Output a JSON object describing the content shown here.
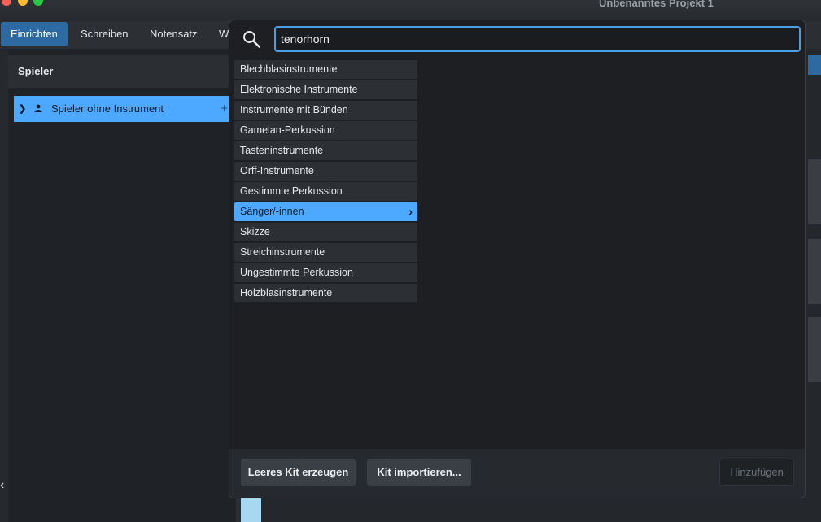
{
  "window": {
    "title": "Unbenanntes Projekt 1"
  },
  "tabs": [
    {
      "label": "Einrichten"
    },
    {
      "label": "Schreiben"
    },
    {
      "label": "Notensatz"
    },
    {
      "label": "W"
    }
  ],
  "players_panel": {
    "header": "Spieler",
    "player": {
      "label": "Spieler ohne Instrument",
      "add_glyph": "+"
    }
  },
  "picker": {
    "search": {
      "value": "tenorhorn",
      "placeholder": ""
    },
    "categories": [
      {
        "label": "Blechblasinstrumente"
      },
      {
        "label": "Elektronische Instrumente"
      },
      {
        "label": "Instrumente mit Bünden"
      },
      {
        "label": "Gamelan-Perkussion"
      },
      {
        "label": "Tasteninstrumente"
      },
      {
        "label": "Orff-Instrumente"
      },
      {
        "label": "Gestimmte Perkussion"
      },
      {
        "label": "Sänger/-innen"
      },
      {
        "label": "Skizze"
      },
      {
        "label": "Streichinstrumente"
      },
      {
        "label": "Ungestimmte Perkussion"
      },
      {
        "label": "Holzblasinstrumente"
      }
    ],
    "selected_category": "Sänger/-innen",
    "buttons": {
      "empty_kit": "Leeres Kit erzeugen",
      "import_kit": "Kit importieren...",
      "add": "Hinzufügen"
    }
  },
  "colors": {
    "accent": "#4da9ff",
    "tab_active": "#2d6aa1",
    "search_border": "#4a9fe4"
  }
}
